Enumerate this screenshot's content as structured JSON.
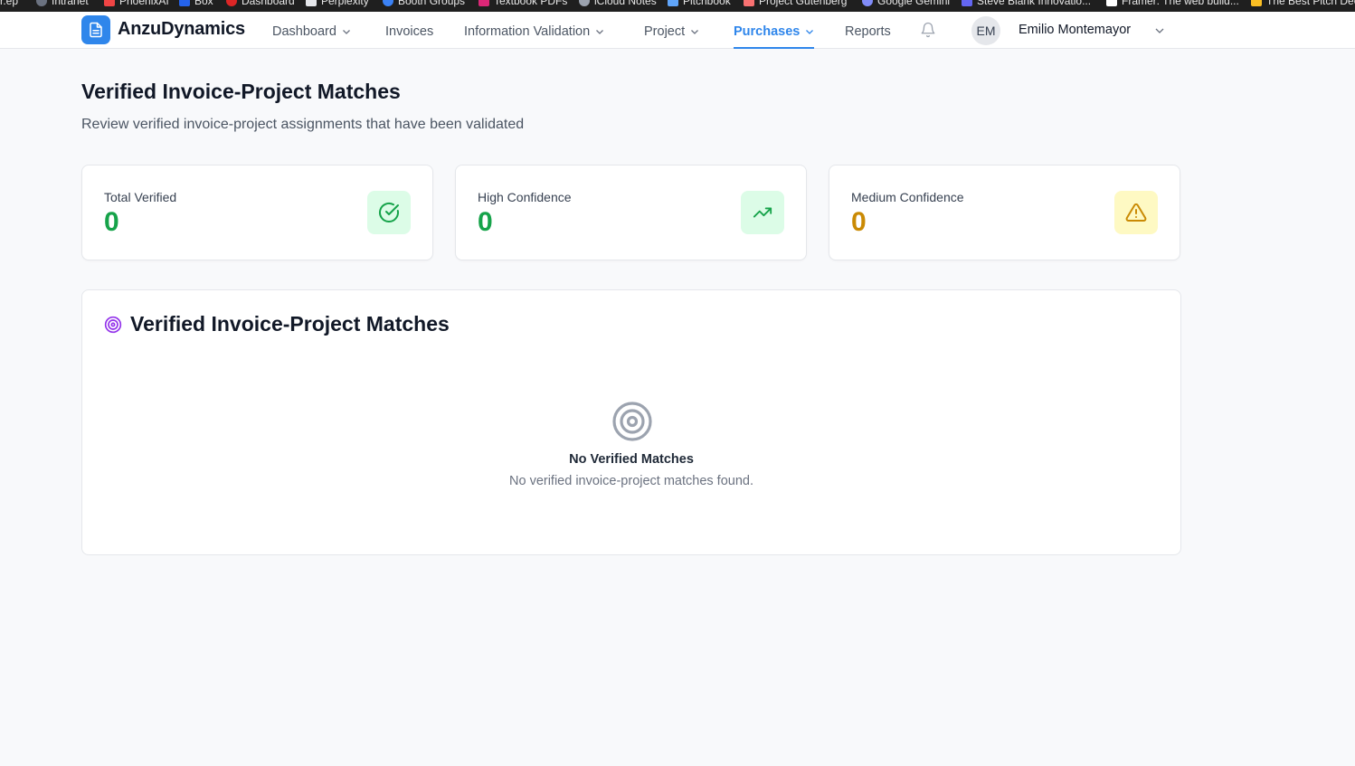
{
  "browser": {
    "bookmarks": [
      {
        "label": "r.ep",
        "color": "#9ca3af"
      },
      {
        "label": "Intranet",
        "color": "#6b7280"
      },
      {
        "label": "PhoenixAI",
        "color": "#ef4444"
      },
      {
        "label": "Box",
        "color": "#2563eb"
      },
      {
        "label": "Dashboard",
        "color": "#dc2626"
      },
      {
        "label": "Perplexity",
        "color": "#e5e7eb"
      },
      {
        "label": "Booth Groups",
        "color": "#3b82f6"
      },
      {
        "label": "Textbook PDFs",
        "color": "#db2777"
      },
      {
        "label": "iCloud Notes",
        "color": "#9ca3af"
      },
      {
        "label": "Pitchbook",
        "color": "#60a5fa"
      },
      {
        "label": "Project Gutenberg",
        "color": "#f87171"
      },
      {
        "label": "Google Gemini",
        "color": "#818cf8"
      },
      {
        "label": "Steve Blank Innovatio...",
        "color": "#6366f1"
      },
      {
        "label": "Framer: The web build...",
        "color": "#ffffff"
      },
      {
        "label": "The Best Pitch Dec",
        "color": "#fbbf24"
      }
    ]
  },
  "nav": {
    "brand": "AnzuDynamics",
    "items": [
      {
        "label": "Dashboard",
        "has_dropdown": true,
        "active": false
      },
      {
        "label": "Invoices",
        "has_dropdown": false,
        "active": false
      },
      {
        "label": "Information Validation",
        "has_dropdown": true,
        "active": false
      },
      {
        "label": "Project",
        "has_dropdown": true,
        "active": false
      },
      {
        "label": "Purchases",
        "has_dropdown": true,
        "active": true
      },
      {
        "label": "Reports",
        "has_dropdown": false,
        "active": false
      }
    ],
    "user": {
      "initials": "EM",
      "name": "Emilio Montemayor"
    }
  },
  "page": {
    "title": "Verified Invoice-Project Matches",
    "subtitle": "Review verified invoice-project assignments that have been validated"
  },
  "stats": [
    {
      "label": "Total Verified",
      "value": "0",
      "icon": "check-circle-icon",
      "accent": "#16a34a",
      "icon_bg": "#dcfce7"
    },
    {
      "label": "High Confidence",
      "value": "0",
      "icon": "trending-up-icon",
      "accent": "#16a34a",
      "icon_bg": "#dcfce7"
    },
    {
      "label": "Medium Confidence",
      "value": "0",
      "icon": "alert-triangle-icon",
      "accent": "#ca8a04",
      "icon_bg": "#fef9c3"
    }
  ],
  "matches_panel": {
    "title": "Verified Invoice-Project Matches",
    "icon": "target-icon",
    "empty_title": "No Verified Matches",
    "empty_message": "No verified invoice-project matches found."
  },
  "colors": {
    "primary": "#2f86eb",
    "target_purple": "#9333ea"
  }
}
